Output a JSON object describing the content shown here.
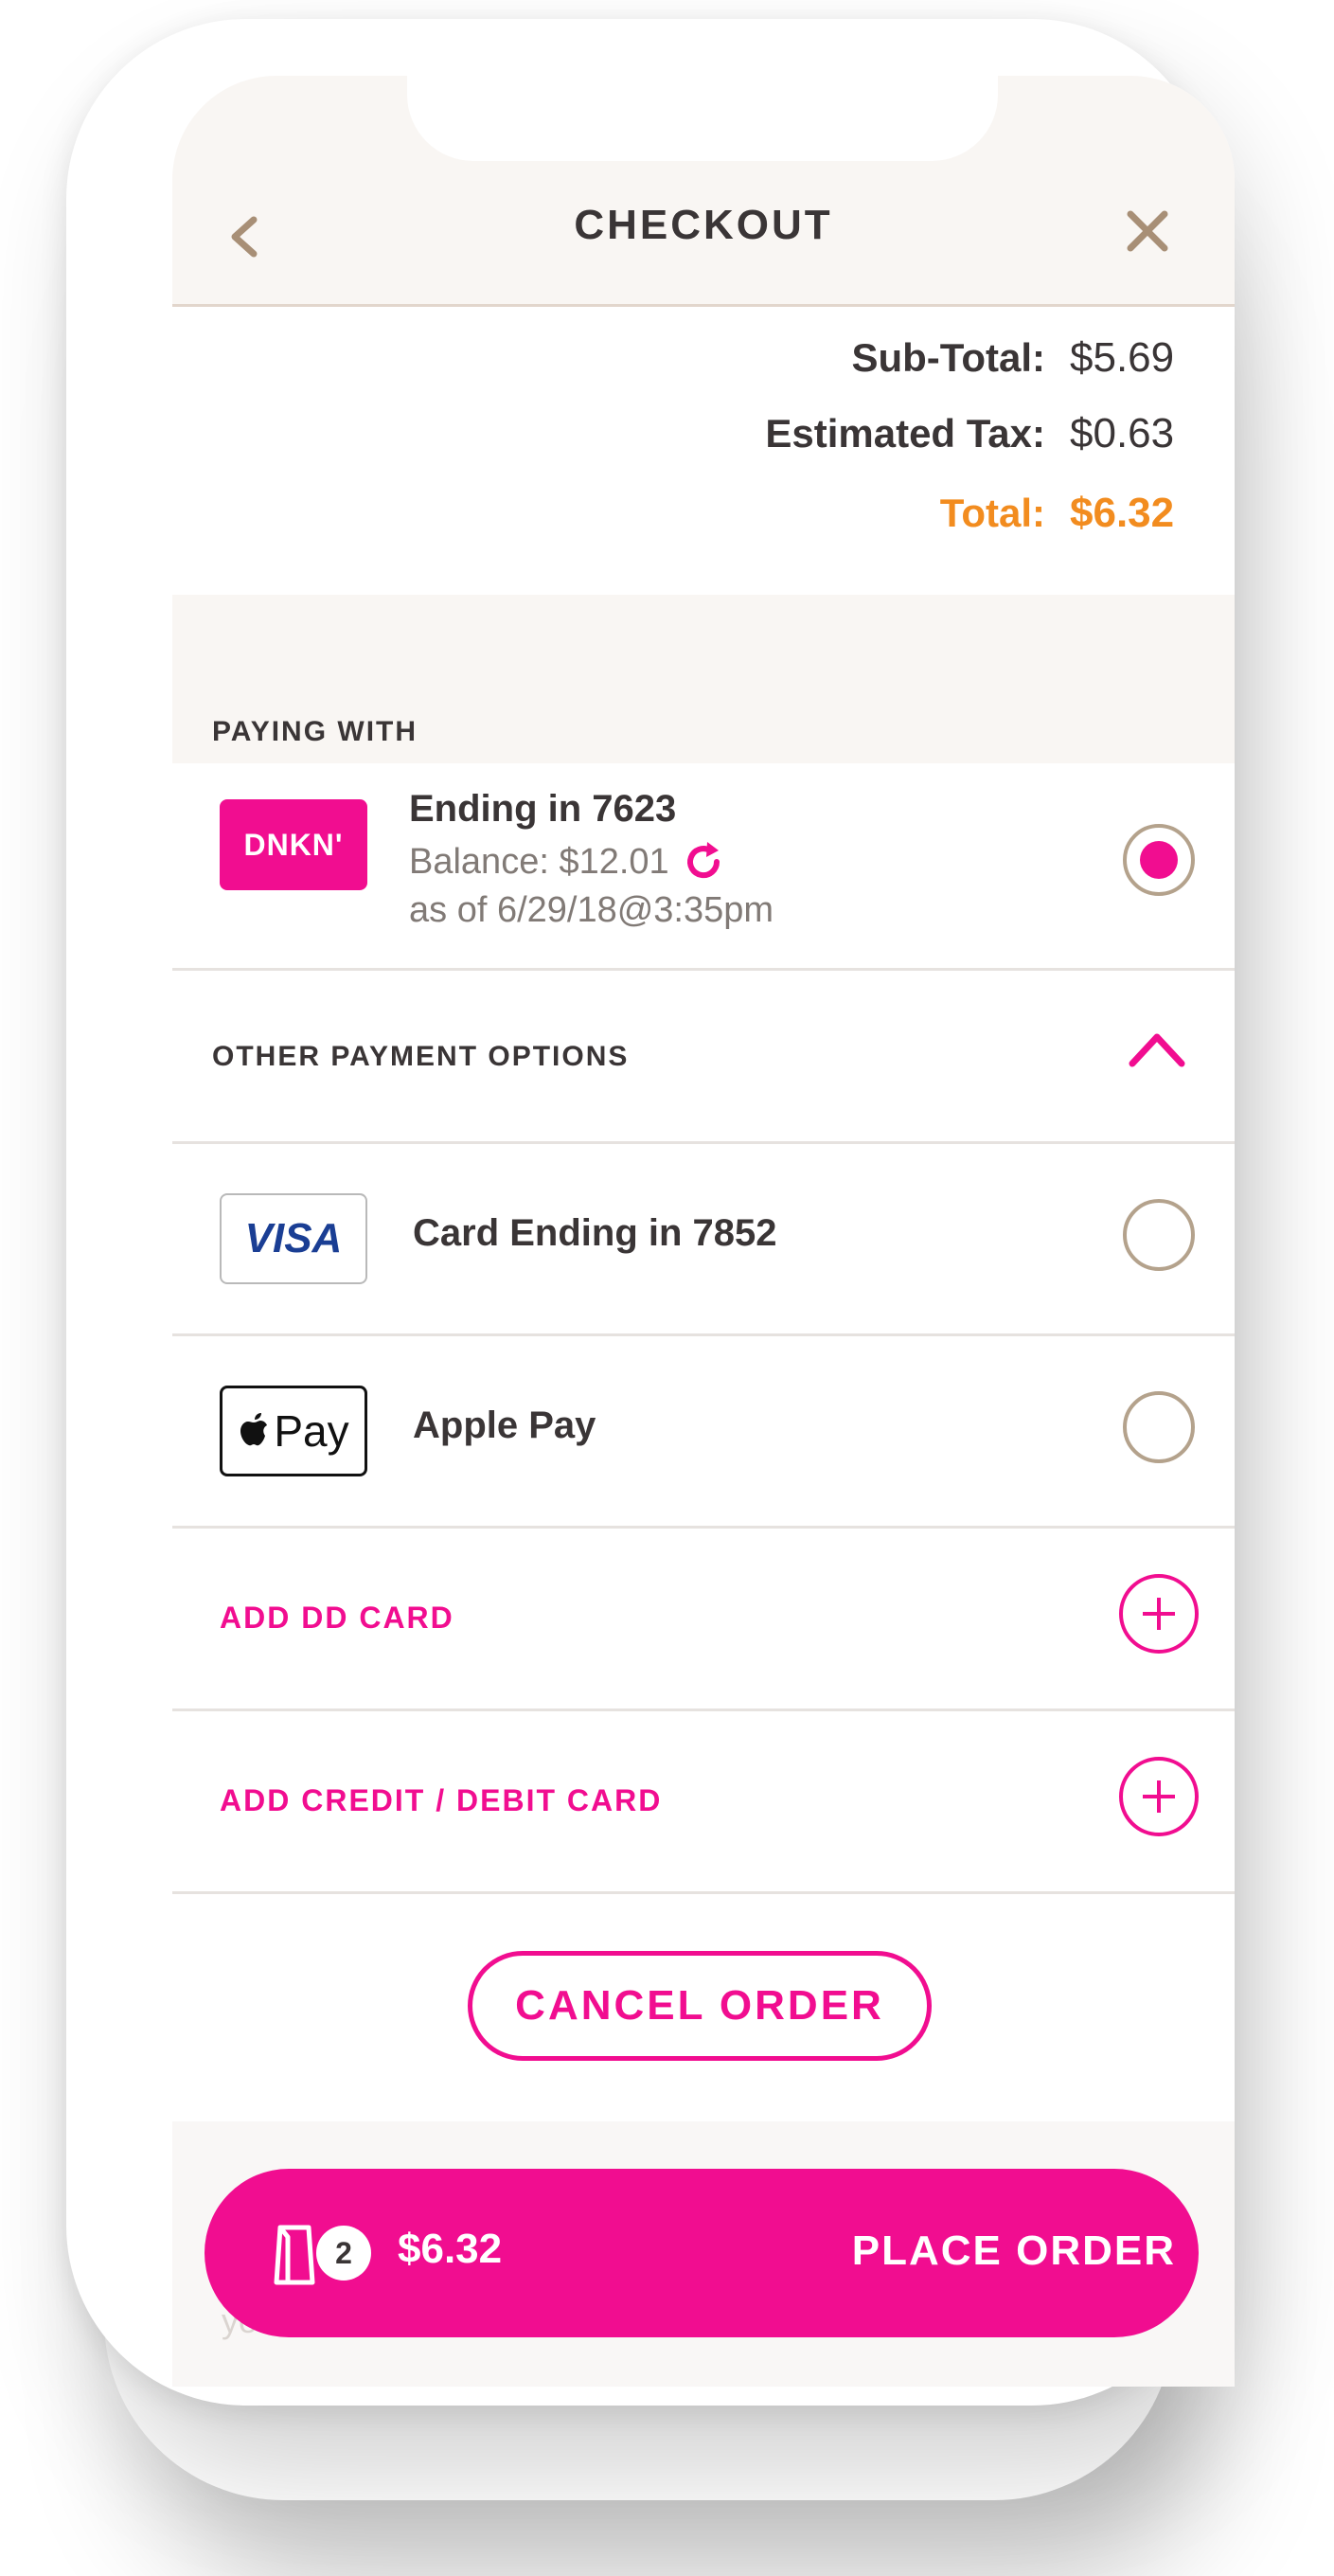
{
  "header": {
    "title": "CHECKOUT"
  },
  "totals": {
    "subtotal_label": "Sub-Total:",
    "subtotal_value": "$5.69",
    "tax_label": "Estimated Tax:",
    "tax_value": "$0.63",
    "total_label": "Total:",
    "total_value": "$6.32"
  },
  "paying_with": {
    "title": "PAYING WITH",
    "card": {
      "logo_text": "DNKN'",
      "title": "Ending in 7623",
      "balance": "Balance: $12.01",
      "as_of": "as of 6/29/18@3:35pm",
      "selected": true
    }
  },
  "other_options": {
    "title": "OTHER PAYMENT OPTIONS",
    "items": [
      {
        "logo": "VISA",
        "label": "Card Ending in 7852",
        "selected": false
      },
      {
        "logo": "Pay",
        "label": "Apple Pay",
        "selected": false
      }
    ]
  },
  "add_actions": [
    {
      "label": "ADD DD CARD"
    },
    {
      "label": "ADD CREDIT / DEBIT CARD"
    }
  ],
  "cancel_label": "CANCEL ORDER",
  "footer_fade_text": "your order.",
  "place_order": {
    "count": "2",
    "total": "$6.32",
    "label": "PLACE ORDER"
  },
  "colors": {
    "brand_pink": "#f10d90",
    "total_orange": "#f28c1f",
    "radio_border": "#b4a28c",
    "header_bg": "#f9f6f3"
  },
  "icons": [
    "back-arrow-icon",
    "close-icon",
    "refresh-icon",
    "chevron-up-icon",
    "plus-icon",
    "bag-icon",
    "apple-icon"
  ]
}
